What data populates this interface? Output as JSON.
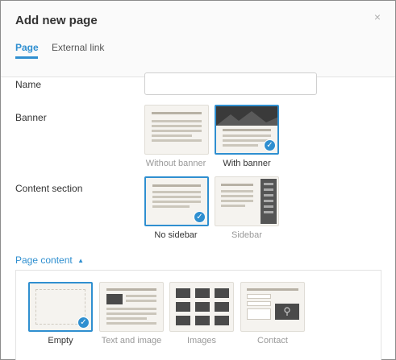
{
  "dialog": {
    "title": "Add new page",
    "close_glyph": "×"
  },
  "tabs": [
    {
      "label": "Page",
      "active": true
    },
    {
      "label": "External link",
      "active": false
    }
  ],
  "form": {
    "name_label": "Name",
    "name_value": "",
    "banner_label": "Banner",
    "content_section_label": "Content section"
  },
  "banner_options": [
    {
      "label": "Without banner",
      "selected": false
    },
    {
      "label": "With banner",
      "selected": true
    }
  ],
  "content_section_options": [
    {
      "label": "No sidebar",
      "selected": true
    },
    {
      "label": "Sidebar",
      "selected": false
    }
  ],
  "page_content": {
    "toggle_label": "Page content",
    "toggle_glyph": "▲",
    "options": [
      {
        "label": "Empty",
        "selected": true
      },
      {
        "label": "Text and image",
        "selected": false
      },
      {
        "label": "Images",
        "selected": false
      },
      {
        "label": "Contact",
        "selected": false
      }
    ]
  },
  "icons": {
    "check": "check-icon",
    "close": "close-icon",
    "caret": "caret-up-icon"
  },
  "colors": {
    "accent": "#2f8fd0",
    "dark_block": "#3a3a3a",
    "thumb_bg": "#f5f3ef"
  }
}
